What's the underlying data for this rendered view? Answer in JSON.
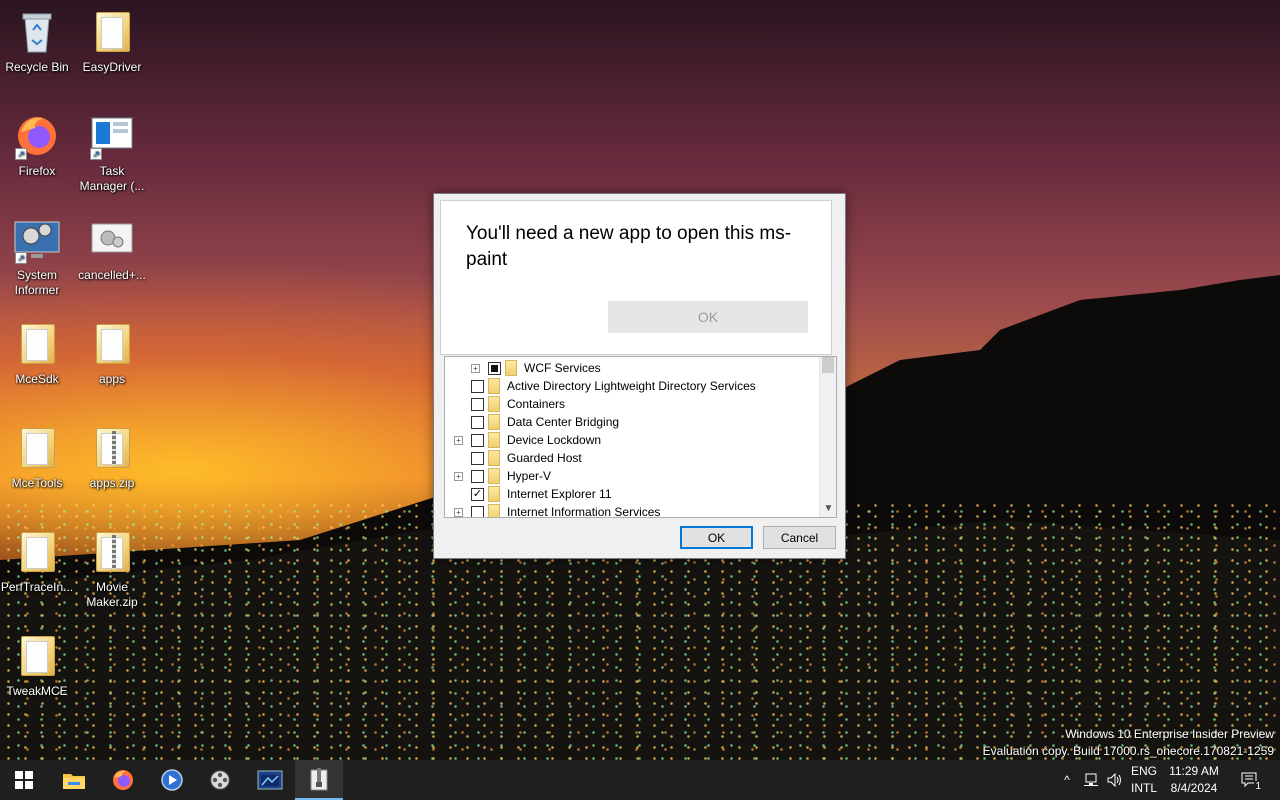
{
  "desktop": {
    "icons": [
      {
        "label": "Recycle Bin"
      },
      {
        "label": "EasyDriver"
      },
      {
        "label": "Firefox"
      },
      {
        "label": "Task Manager (..."
      },
      {
        "label": "System Informer"
      },
      {
        "label": "cancelled+..."
      },
      {
        "label": "MceSdk"
      },
      {
        "label": "apps"
      },
      {
        "label": "MceTools"
      },
      {
        "label": "apps.zip"
      },
      {
        "label": "PerfTraceIn..."
      },
      {
        "label": "Movie Maker.zip"
      },
      {
        "label": "TweakMCE"
      }
    ],
    "watermark": {
      "line1": "Windows 10 Enterprise Insider Preview",
      "line2": "Evaluation copy. Build 17000.rs_onecore.170821-1259"
    }
  },
  "popup": {
    "title": "You'll need a new app to open this ms-paint",
    "ok_label": "OK"
  },
  "dialog": {
    "tree": [
      {
        "label": "WCF Services",
        "state": "partial",
        "expandable": true
      },
      {
        "label": "Active Directory Lightweight Directory Services",
        "state": "unchecked",
        "expandable": false
      },
      {
        "label": "Containers",
        "state": "unchecked",
        "expandable": false
      },
      {
        "label": "Data Center Bridging",
        "state": "unchecked",
        "expandable": false
      },
      {
        "label": "Device Lockdown",
        "state": "unchecked",
        "expandable": true
      },
      {
        "label": "Guarded Host",
        "state": "unchecked",
        "expandable": false
      },
      {
        "label": "Hyper-V",
        "state": "unchecked",
        "expandable": true
      },
      {
        "label": "Internet Explorer 11",
        "state": "checked",
        "expandable": false
      },
      {
        "label": "Internet Information Services",
        "state": "unchecked",
        "expandable": true
      }
    ],
    "ok_label": "OK",
    "cancel_label": "Cancel"
  },
  "taskbar": {
    "language_top": "ENG",
    "language_bottom": "INTL",
    "time": "11:29 AM",
    "date": "8/4/2024",
    "notification_count": "1"
  }
}
